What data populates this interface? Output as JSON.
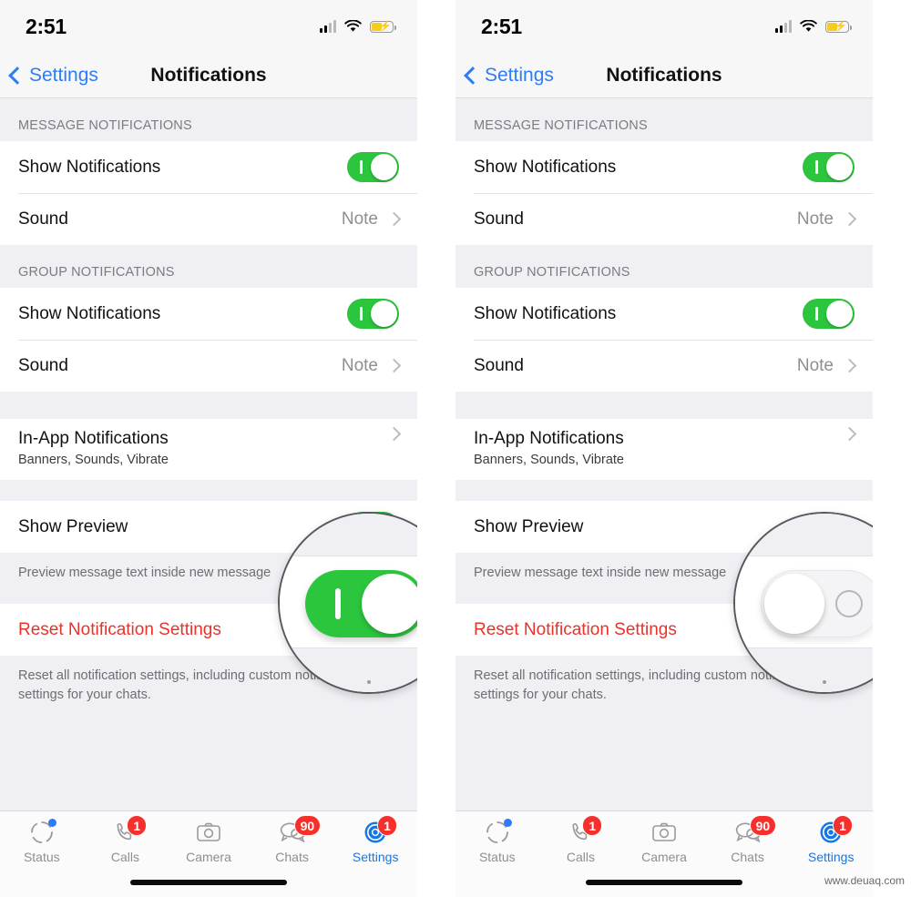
{
  "status_bar": {
    "time": "2:51",
    "signal_icon": "cellular-bars-icon",
    "wifi_icon": "wifi-icon",
    "battery_icon": "battery-charging-icon"
  },
  "nav": {
    "back_label": "Settings",
    "back_icon": "chevron-left-icon",
    "title": "Notifications"
  },
  "sections": {
    "message_header": "MESSAGE NOTIFICATIONS",
    "group_header": "GROUP NOTIFICATIONS"
  },
  "rows": {
    "show_notifications": "Show Notifications",
    "sound": "Sound",
    "sound_value": "Note",
    "in_app": "In-App Notifications",
    "in_app_sub": "Banners, Sounds, Vibrate",
    "show_preview": "Show Preview",
    "preview_footnote": "Preview message text inside new message",
    "reset": "Reset Notification Settings",
    "reset_footnote": "Reset all notification settings, including custom notification settings for your chats."
  },
  "tabbar": {
    "items": [
      {
        "label": "Status",
        "icon": "status-ring-icon",
        "badge": ""
      },
      {
        "label": "Calls",
        "icon": "phone-icon",
        "badge": "1"
      },
      {
        "label": "Camera",
        "icon": "camera-icon",
        "badge": ""
      },
      {
        "label": "Chats",
        "icon": "chat-bubbles-icon",
        "badge": "90"
      },
      {
        "label": "Settings",
        "icon": "gear-icon",
        "badge": "1"
      }
    ]
  },
  "colors": {
    "toggle_on": "#2CC63E",
    "accent_blue": "#2D7CF6",
    "destructive_red": "#E8322B",
    "badge_red": "#F5302C",
    "group_background": "#EFEFF4",
    "battery_yellow": "#F6CC1F"
  },
  "magnifier": {
    "left_state": "on",
    "right_state": "off",
    "target_row": "Show Preview"
  },
  "watermark": "www.deuaq.com"
}
